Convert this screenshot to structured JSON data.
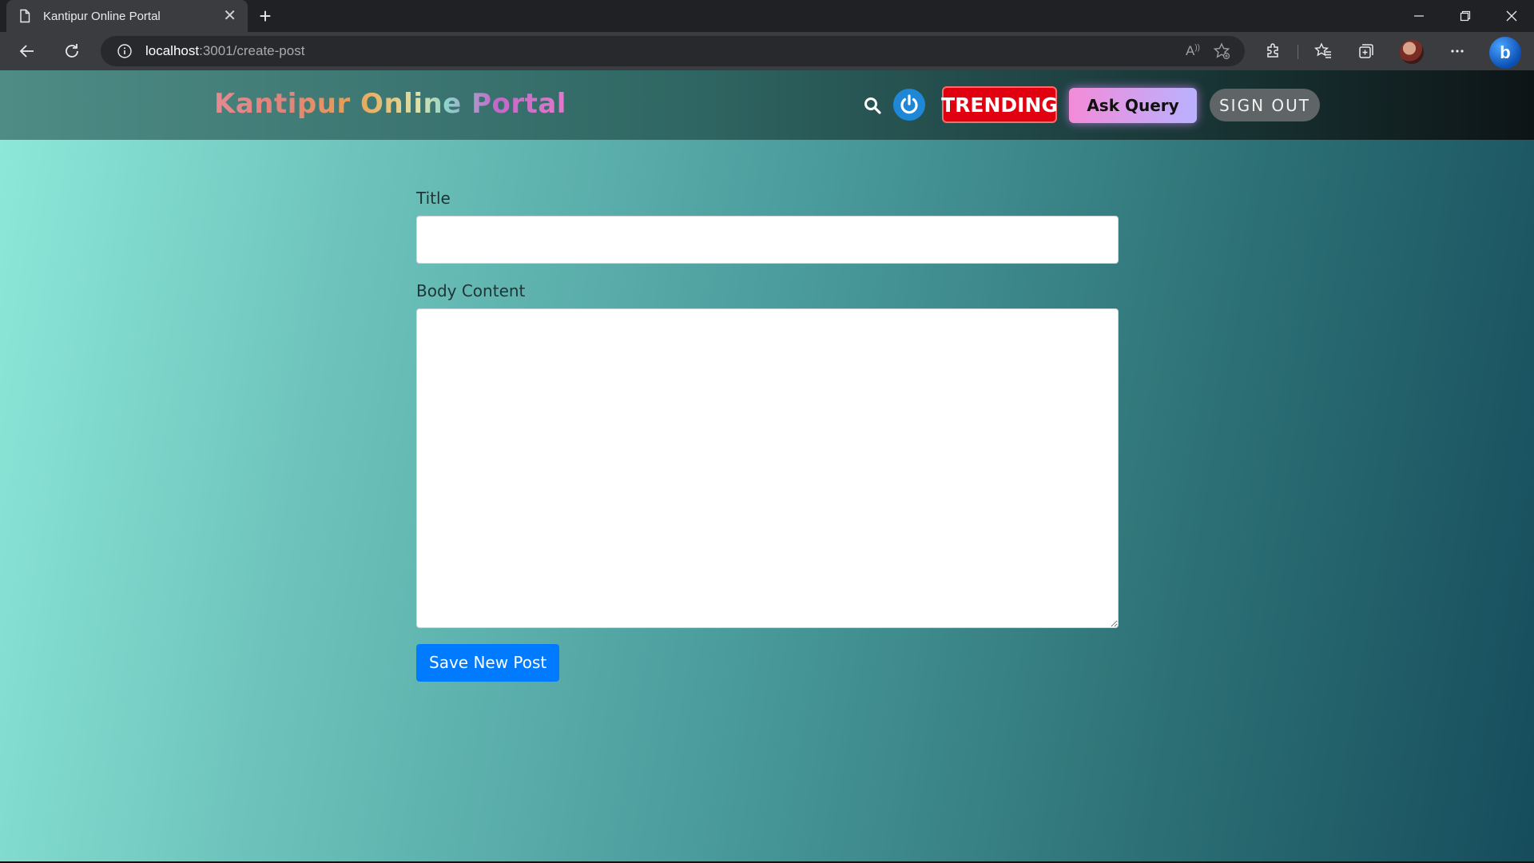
{
  "browser": {
    "tab_title": "Kantipur Online Portal",
    "url_host": "localhost",
    "url_path": ":3001/create-post"
  },
  "navbar": {
    "brand": "Kantipur Online Portal",
    "trending_label": "TRENDING",
    "ask_query_label": "Ask Query",
    "sign_out_label": "SIGN OUT"
  },
  "form": {
    "title_label": "Title",
    "title_value": "",
    "body_label": "Body Content",
    "body_value": "",
    "save_label": "Save New Post"
  },
  "colors": {
    "trending_bg": "#e00010",
    "save_button": "#007bff",
    "power_button": "#1e88d6",
    "sign_out_bg": "#5f6466"
  }
}
